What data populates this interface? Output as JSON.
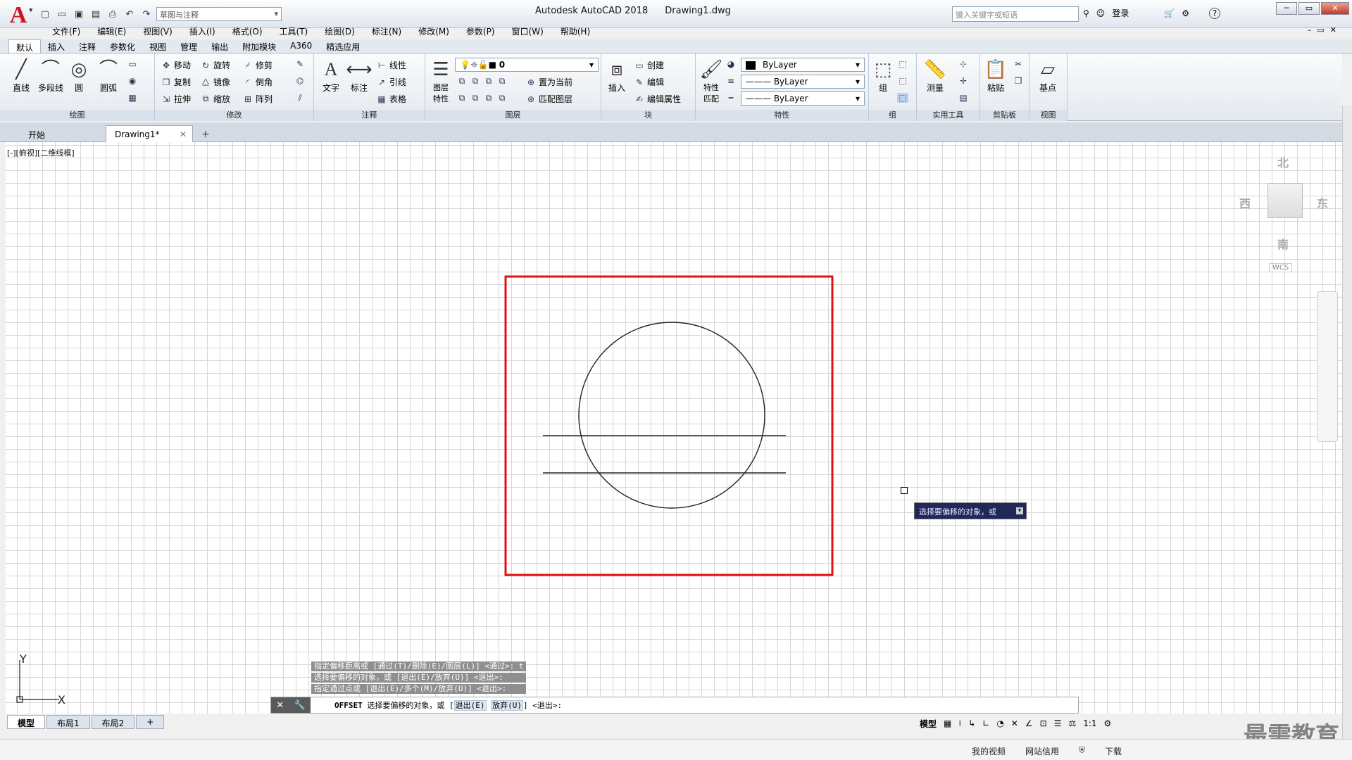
{
  "app": {
    "title": "Autodesk AutoCAD 2018",
    "file": "Drawing1.dwg",
    "workspace": "草图与注释",
    "search_placeholder": "键入关键字或短语",
    "login": "登录",
    "help": "?"
  },
  "menus": [
    "文件(F)",
    "编辑(E)",
    "视图(V)",
    "插入(I)",
    "格式(O)",
    "工具(T)",
    "绘图(D)",
    "标注(N)",
    "修改(M)",
    "参数(P)",
    "窗口(W)",
    "帮助(H)"
  ],
  "ribbon_tabs": [
    "默认",
    "插入",
    "注释",
    "参数化",
    "视图",
    "管理",
    "输出",
    "附加模块",
    "A360",
    "精选应用"
  ],
  "panels": {
    "draw": {
      "title": "绘图",
      "line": "直线",
      "polyline": "多段线",
      "circle": "圆",
      "arc": "圆弧"
    },
    "modify": {
      "title": "修改",
      "move": "移动",
      "rotate": "旋转",
      "trim": "修剪",
      "copy": "复制",
      "mirror": "镜像",
      "fillet": "倒角",
      "stretch": "拉伸",
      "scale": "缩放",
      "array": "阵列"
    },
    "annotation": {
      "title": "注释",
      "text": "文字",
      "dimension": "标注",
      "linear": "线性",
      "leader": "引线",
      "table": "表格"
    },
    "layers": {
      "title": "图层",
      "layer_props": "图层特性",
      "current_layer": "0",
      "set_current": "置为当前",
      "match_layer": "匹配图层"
    },
    "block": {
      "title": "块",
      "insert": "插入",
      "create": "创建",
      "edit": "编辑",
      "edit_attr": "编辑属性"
    },
    "properties": {
      "title": "特性",
      "match": "特性匹配",
      "color": "ByLayer",
      "linetype": "ByLayer",
      "lineweight": "ByLayer"
    },
    "groups": {
      "title": "组",
      "group": "组"
    },
    "utilities": {
      "title": "实用工具",
      "measure": "测量"
    },
    "clipboard": {
      "title": "剪贴板",
      "paste": "粘贴"
    },
    "view": {
      "title": "视图",
      "base": "基点"
    }
  },
  "doc_tabs": {
    "start": "开始",
    "drawing": "Drawing1*"
  },
  "viewport_label": "[-][俯视][二维线框]",
  "viewcube": {
    "north": "北",
    "south": "南",
    "east": "东",
    "west": "西",
    "wcs": "WCS"
  },
  "tooltip": "选择要偏移的对象，或",
  "command_history": [
    "指定偏移距离或 [通过(T)/删除(E)/图层(L)] <通过>: t",
    "选择要偏移的对象，或 [退出(E)/放弃(U)] <退出>:",
    "指定通过点或 [退出(E)/多个(M)/放弃(U)] <退出>:"
  ],
  "command_line": {
    "cmd": "OFFSET",
    "prompt": "选择要偏移的对象，或 [",
    "opt1": "退出(E)",
    "opt2": "放弃(U)",
    "end": "] <退出>:"
  },
  "layout_tabs": [
    "模型",
    "布局1",
    "布局2"
  ],
  "status": {
    "model": "模型",
    "scale": "1:1"
  },
  "bottom": {
    "videos": "我的视频",
    "credit": "网站信用",
    "download": "下载"
  },
  "watermark": "最需教育",
  "ucs": {
    "x": "X",
    "y": "Y"
  }
}
